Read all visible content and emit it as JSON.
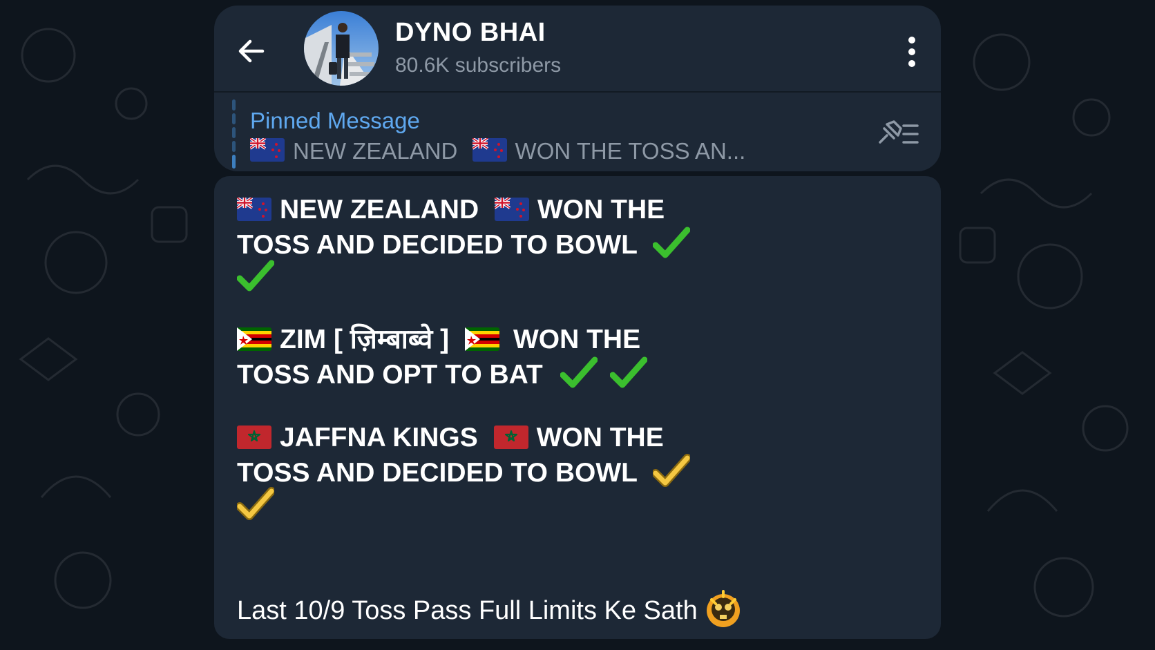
{
  "channel": {
    "name": "DYNO BHAI",
    "subscribers": "80.6K subscribers"
  },
  "pinned": {
    "title": "Pinned Message",
    "preview_part1": "NEW ZEALAND",
    "preview_part2": "WON THE TOSS AN..."
  },
  "message": {
    "block1": {
      "team": "NEW ZEALAND",
      "line1_rest": "WON THE",
      "line2": "TOSS AND DECIDED TO BOWL"
    },
    "block2": {
      "team": "ZIM [ ज़िम्बाब्वे ]",
      "line1_rest": "WON THE",
      "line2": "TOSS AND OPT TO BAT"
    },
    "block3": {
      "team": "JAFFNA KINGS",
      "line1_rest": "WON THE",
      "line2": "TOSS AND DECIDED TO BOWL"
    },
    "footer": "Last 10/9 Toss Pass Full Limits Ke Sath"
  },
  "icons": [
    "back-arrow-icon",
    "more-vertical-icon",
    "pin-list-icon",
    "new-zealand-flag-icon",
    "zimbabwe-flag-icon",
    "morocco-flag-icon",
    "green-check-icon",
    "gold-check-icon",
    "skull-emoji-icon"
  ],
  "colors": {
    "background": "#0e151d",
    "panel": "#1d2836",
    "accent": "#5fa8ef",
    "secondary_text": "#8e99a6"
  }
}
